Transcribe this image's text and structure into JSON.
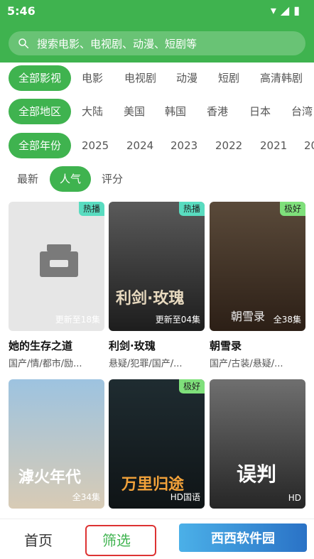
{
  "statusbar": {
    "time": "5:46"
  },
  "search": {
    "placeholder": "搜索电影、电视剧、动漫、短剧等"
  },
  "filters": {
    "types": [
      "全部影视",
      "电影",
      "电视剧",
      "动漫",
      "短剧",
      "高清韩剧"
    ],
    "regions": [
      "全部地区",
      "大陆",
      "美国",
      "韩国",
      "香港",
      "日本",
      "台湾"
    ],
    "years": [
      "全部年份",
      "2025",
      "2024",
      "2023",
      "2022",
      "2021",
      "20"
    ],
    "sort": [
      "最新",
      "人气",
      "评分"
    ]
  },
  "items": [
    {
      "title": "她的生存之道",
      "subtitle": "国产/情/都市/励...",
      "badge": "热播",
      "episodes": "更新至18集"
    },
    {
      "title": "利剑·玫瑰",
      "subtitle": "悬疑/犯罪/国产/...",
      "badge": "热播",
      "episodes": "更新至04集",
      "poster_text": "利剑·玫瑰"
    },
    {
      "title": "朝雪录",
      "subtitle": "国产/古装/悬疑/...",
      "badge": "极好",
      "episodes": "全38集",
      "poster_text": "朝雪录"
    },
    {
      "title": "",
      "subtitle": "",
      "badge": "",
      "episodes": "全34集",
      "poster_text": "滹火年代"
    },
    {
      "title": "",
      "subtitle": "",
      "badge": "极好",
      "episodes": "HD国语",
      "poster_text": "万里归途"
    },
    {
      "title": "",
      "subtitle": "",
      "badge": "",
      "episodes": "HD",
      "poster_text": "误判"
    }
  ],
  "tabs": {
    "home": "首页",
    "filter": "筛选"
  },
  "watermark": {
    "text": "西西软件园"
  }
}
